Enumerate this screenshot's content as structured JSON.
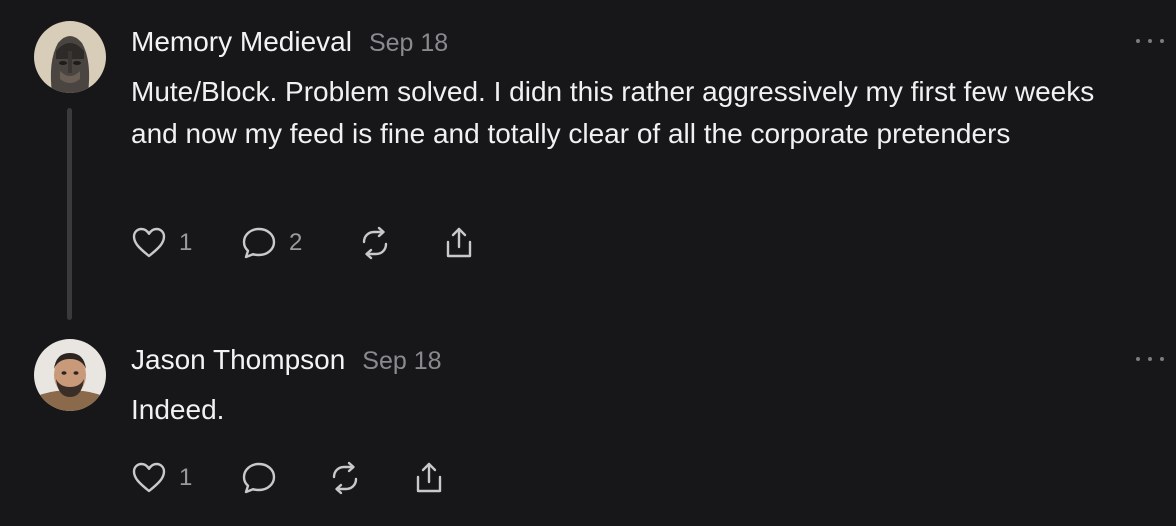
{
  "posts": [
    {
      "author": "Memory Medieval",
      "date": "Sep 18",
      "text": "Mute/Block. Problem solved. I didn this rather aggressively my first few weeks and now my feed is fine and totally clear of all the corporate pretenders",
      "like_count": "1",
      "reply_count": "2",
      "icons": [
        "heart-icon",
        "comment-icon",
        "repost-icon",
        "share-icon",
        "more-icon"
      ]
    },
    {
      "author": "Jason Thompson",
      "date": "Sep 18",
      "text": "Indeed.",
      "like_count": "1",
      "icons": [
        "heart-icon",
        "comment-icon",
        "repost-icon",
        "share-icon",
        "more-icon"
      ]
    }
  ],
  "colors": {
    "background": "#17171a",
    "text": "#f1f1f1",
    "muted": "#8a8a8e",
    "thread_line": "#3a3a3d"
  }
}
